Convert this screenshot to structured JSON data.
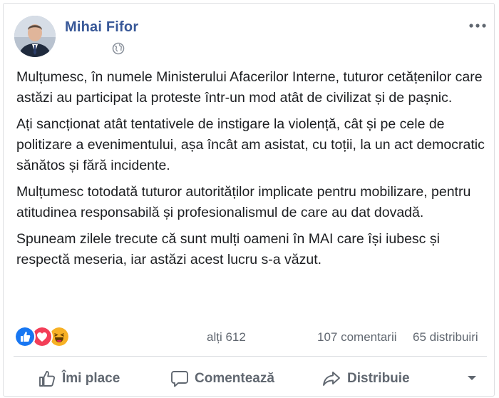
{
  "post": {
    "author": "Mihai Fifor",
    "audience_icon": "globe-icon",
    "more_icon": "ellipsis-icon",
    "paragraphs": [
      "Mulțumesc, în numele Ministerului Afacerilor Interne, tuturor cetățenilor care astăzi au participat la proteste într-un mod atât de civilizat și de pașnic.",
      "Ați sancționat atât tentativele de instigare la violență, cât și pe cele de politizare a evenimentului, așa încât am asistat, cu toții, la un act democratic sănătos și fără incidente.",
      "Mulțumesc totodată tuturor autorităților implicate pentru mobilizare, pentru atitudinea responsabilă și profesionalismul de care au dat dovadă.",
      "Spuneam zilele trecute că sunt mulți oameni în MAI care își iubesc și respectă meseria, iar astăzi acest lucru s-a văzut."
    ]
  },
  "stats": {
    "reactions": [
      "like-reaction-icon",
      "love-reaction-icon",
      "haha-reaction-icon"
    ],
    "others": "alți 612",
    "comments": "107 comentarii",
    "shares": "65 distribuiri"
  },
  "actions": {
    "like": "Îmi place",
    "comment": "Comentează",
    "share": "Distribuie"
  },
  "colors": {
    "author": "#385898",
    "muted": "#606770",
    "like": "#1877f2",
    "love": "#f33e58",
    "haha": "#f7b125"
  }
}
